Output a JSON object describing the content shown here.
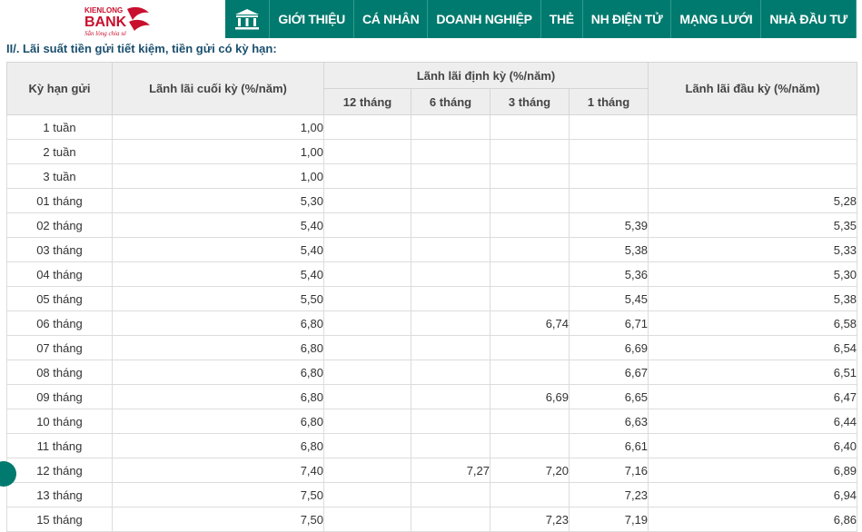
{
  "brand": {
    "name_top": "KIENLONG",
    "name_main": "BANK",
    "slogan": "Sẵn lòng chia sẻ",
    "color": "#007a6e"
  },
  "nav": {
    "home_icon": "bank-building-icon",
    "items": [
      "GIỚI THIỆU",
      "CÁ NHÂN",
      "DOANH NGHIỆP",
      "THẺ",
      "NH ĐIỆN TỬ",
      "MẠNG LƯỚI",
      "NHÀ ĐẦU TƯ"
    ]
  },
  "section_title": "II/. Lãi suất tiền gửi tiết kiệm, tiền gửi có kỳ hạn:",
  "table": {
    "headers": {
      "term": "Kỳ hạn gửi",
      "end": "Lãnh lãi cuối kỳ (%/năm)",
      "periodic": "Lãnh lãi định kỳ (%/năm)",
      "periodic_sub": [
        "12 tháng",
        "6 tháng",
        "3 tháng",
        "1 tháng"
      ],
      "upfront": "Lãnh lãi đầu kỳ (%/năm)"
    },
    "rows": [
      [
        "1 tuần",
        "1,00",
        "",
        "",
        "",
        "",
        ""
      ],
      [
        "2 tuần",
        "1,00",
        "",
        "",
        "",
        "",
        ""
      ],
      [
        "3 tuần",
        "1,00",
        "",
        "",
        "",
        "",
        ""
      ],
      [
        "01 tháng",
        "5,30",
        "",
        "",
        "",
        "",
        "5,28"
      ],
      [
        "02 tháng",
        "5,40",
        "",
        "",
        "",
        "5,39",
        "5,35"
      ],
      [
        "03 tháng",
        "5,40",
        "",
        "",
        "",
        "5,38",
        "5,33"
      ],
      [
        "04 tháng",
        "5,40",
        "",
        "",
        "",
        "5,36",
        "5,30"
      ],
      [
        "05 tháng",
        "5,50",
        "",
        "",
        "",
        "5,45",
        "5,38"
      ],
      [
        "06 tháng",
        "6,80",
        "",
        "",
        "6,74",
        "6,71",
        "6,58"
      ],
      [
        "07 tháng",
        "6,80",
        "",
        "",
        "",
        "6,69",
        "6,54"
      ],
      [
        "08 tháng",
        "6,80",
        "",
        "",
        "",
        "6,67",
        "6,51"
      ],
      [
        "09 tháng",
        "6,80",
        "",
        "",
        "6,69",
        "6,65",
        "6,47"
      ],
      [
        "10 tháng",
        "6,80",
        "",
        "",
        "",
        "6,63",
        "6,44"
      ],
      [
        "11 tháng",
        "6,80",
        "",
        "",
        "",
        "6,61",
        "6,40"
      ],
      [
        "12 tháng",
        "7,40",
        "",
        "7,27",
        "7,20",
        "7,16",
        "6,89"
      ],
      [
        "13 tháng",
        "7,50",
        "",
        "",
        "",
        "7,23",
        "6,94"
      ],
      [
        "15 tháng",
        "7,50",
        "",
        "",
        "7,23",
        "7,19",
        "6,86"
      ]
    ]
  }
}
